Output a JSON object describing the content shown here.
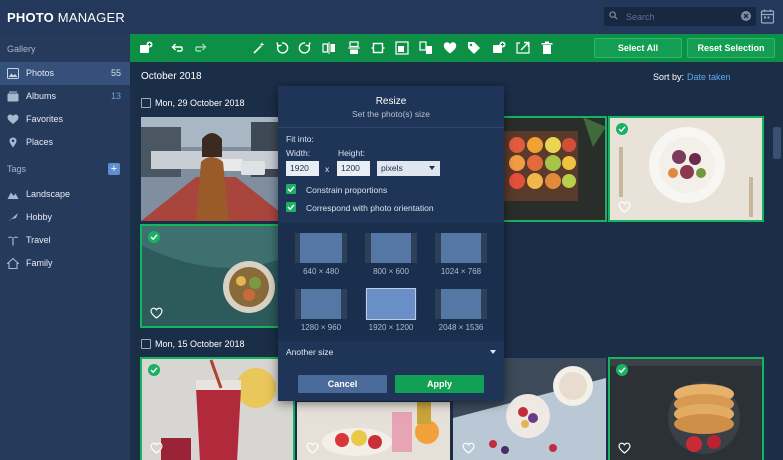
{
  "app": {
    "title_bold": "PHOTO",
    "title_rest": " MANAGER"
  },
  "search": {
    "placeholder": "Search"
  },
  "sidebar": {
    "gallery_heading": "Gallery",
    "items": [
      {
        "label": "Photos",
        "count": "55",
        "icon": "photos-icon",
        "active": true
      },
      {
        "label": "Albums",
        "count": "13",
        "icon": "albums-icon"
      },
      {
        "label": "Favorites",
        "count": "",
        "icon": "heart-icon"
      },
      {
        "label": "Places",
        "count": "",
        "icon": "map-pin-icon"
      }
    ],
    "tags_heading": "Tags",
    "tags": [
      {
        "label": "Landscape",
        "icon": "landscape-icon"
      },
      {
        "label": "Hobby",
        "icon": "hobby-icon"
      },
      {
        "label": "Travel",
        "icon": "palm-icon"
      },
      {
        "label": "Family",
        "icon": "home-icon"
      }
    ]
  },
  "toolbar": {
    "select_all": "Select All",
    "reset_selection": "Reset Selection",
    "colors": {
      "bar": "#0d8f46",
      "accent": "#17b45f"
    }
  },
  "content": {
    "month": "October 2018",
    "sort_label": "Sort by:",
    "sort_value": "Date taken",
    "groups": [
      {
        "date": "Mon, 29 October 2018"
      },
      {
        "date": "Mon, 15 October 2018"
      }
    ]
  },
  "dialog": {
    "title": "Resize",
    "subtitle": "Set the photo(s) size",
    "fit_into": "Fit into:",
    "width_label": "Width:",
    "height_label": "Height:",
    "width_value": "1920",
    "x_sep": "x",
    "height_value": "1200",
    "unit": "pixels",
    "constrain": "Constrain proportions",
    "orientation": "Correspond with photo orientation",
    "presets": [
      "640 × 480",
      "800 × 600",
      "1024 × 768",
      "1280 × 960",
      "1920 × 1200",
      "2048 × 1536"
    ],
    "active_preset": "1920 × 1200",
    "another_size": "Another size",
    "cancel": "Cancel",
    "apply": "Apply"
  }
}
